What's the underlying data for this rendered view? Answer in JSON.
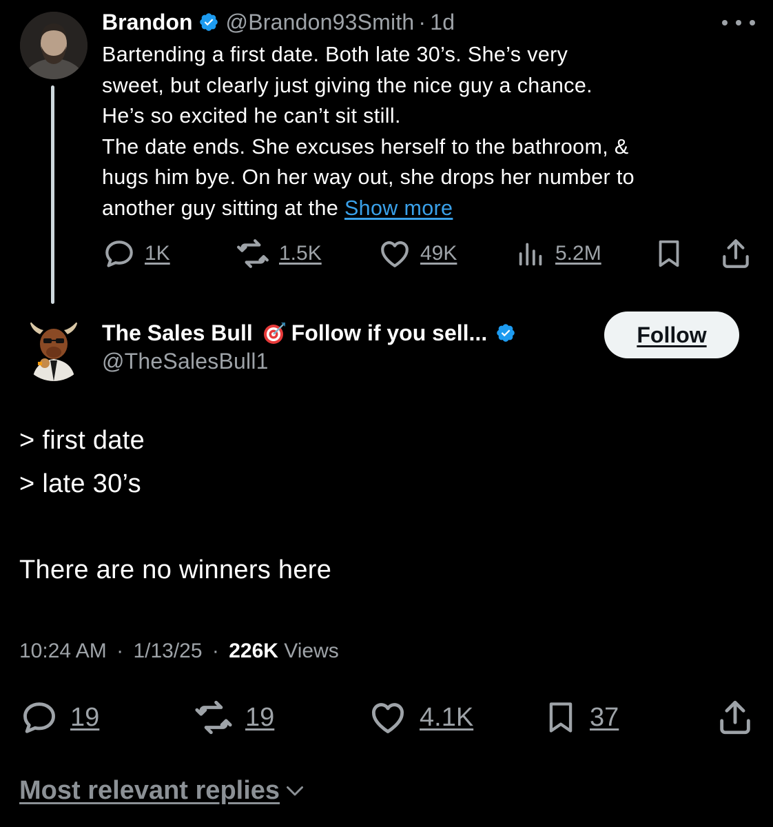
{
  "parent_tweet": {
    "author_name": "Brandon",
    "verified": true,
    "handle": "@Brandon93Smith",
    "separator": "·",
    "age": "1d",
    "text_lines": [
      "Bartending a first date. Both late 30’s. She’s very",
      "sweet, but clearly just giving the nice guy a chance.",
      "He’s so excited he can’t sit still.",
      "The date ends. She excuses herself to the bathroom, &",
      "hugs him bye. On her way out, she drops her number to",
      "another guy sitting at the "
    ],
    "show_more_label": "Show more",
    "replies": "1K",
    "reposts": "1.5K",
    "likes": "49K",
    "views": "5.2M"
  },
  "reply_tweet": {
    "author_name": "The Sales Bull",
    "name_suffix": "Follow if you sell...",
    "verified": true,
    "handle": "@TheSalesBull1",
    "follow_label": "Follow",
    "body_lines": [
      "> first date",
      "> late 30’s",
      "There are no winners here"
    ],
    "time": "10:24 AM",
    "date": "1/13/25",
    "separator": "·",
    "views_count": "226K",
    "views_label": "Views",
    "replies": "19",
    "reposts": "19",
    "likes": "4.1K",
    "bookmarks": "37"
  },
  "replies_sort_label": "Most relevant replies",
  "colors": {
    "background": "#000000",
    "text_primary": "#e7e9ea",
    "text_secondary": "#9ea3a8",
    "link_blue": "#3aa1ea",
    "verified_blue": "#1d9bf0",
    "follow_button_bg": "#eff3f4"
  },
  "icons": [
    "verified-badge-icon",
    "more-icon",
    "reply-icon",
    "repost-icon",
    "like-icon",
    "views-icon",
    "bookmark-icon",
    "share-icon",
    "direct-hit-icon",
    "chevron-down-icon"
  ]
}
